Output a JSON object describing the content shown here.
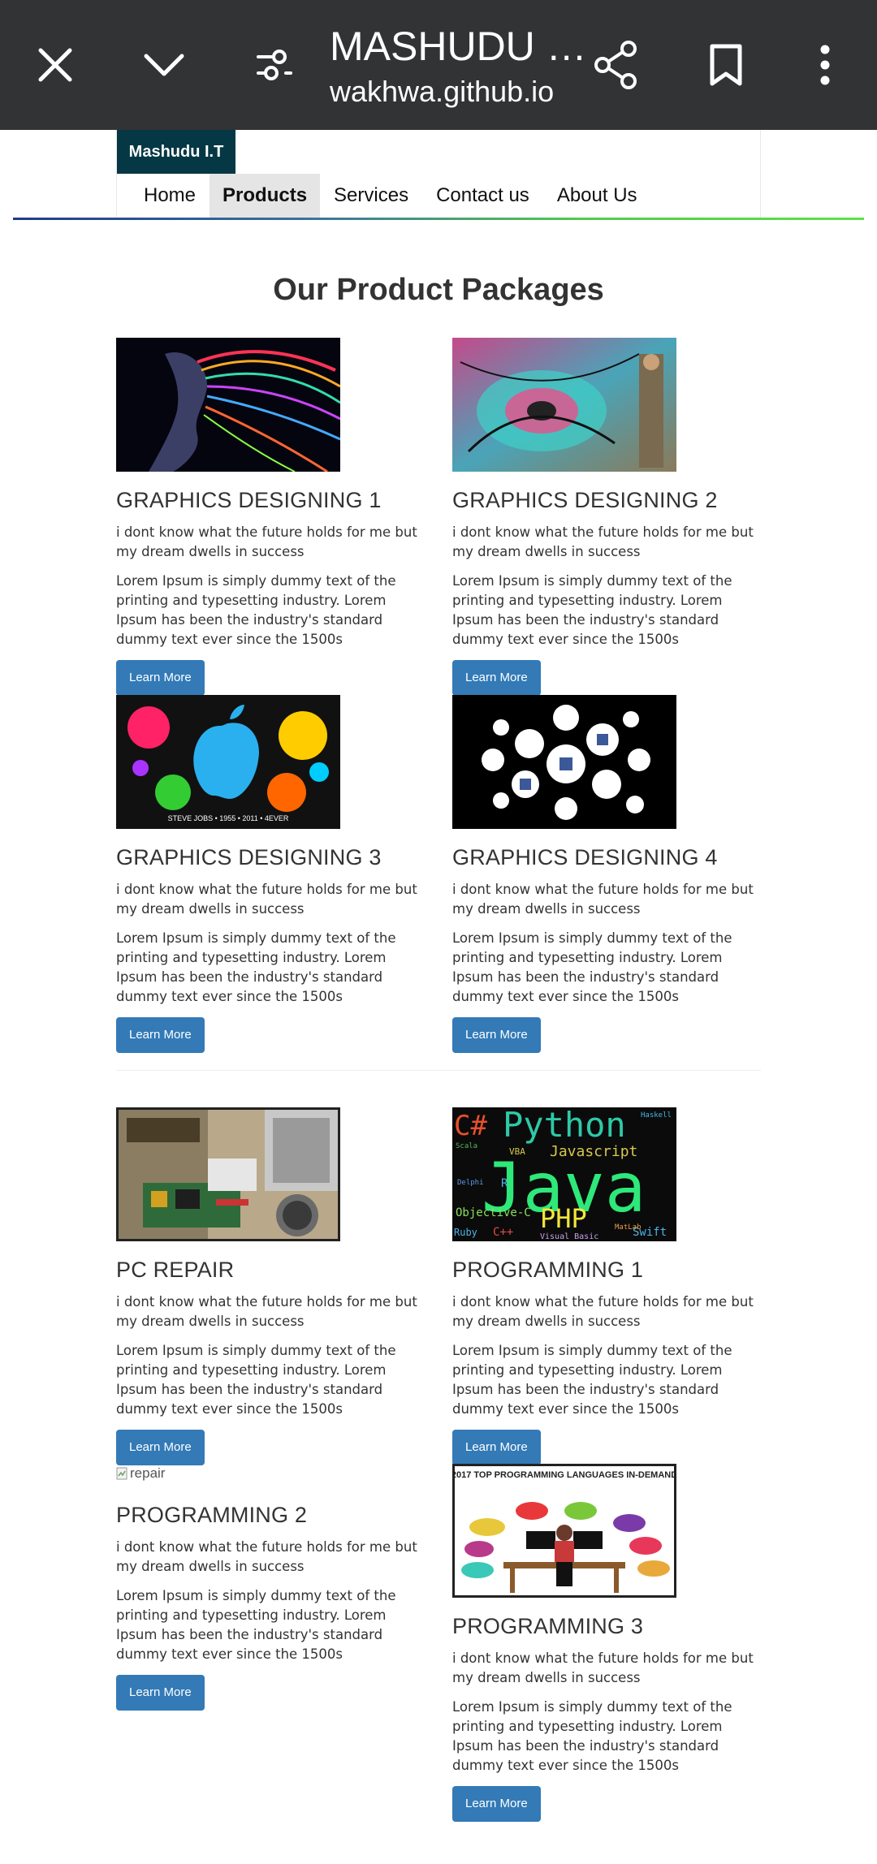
{
  "browser": {
    "title": "MASHUDU …",
    "url": "wakhwa.github.io",
    "icons": [
      "close-icon",
      "chevron-down-icon",
      "settings-sliders-icon",
      "share-icon",
      "bookmark-icon",
      "more-vert-icon"
    ]
  },
  "nav": {
    "brand": "Mashudu I.T",
    "links": [
      "Home",
      "Products",
      "Services",
      "Contact us",
      "About Us"
    ],
    "active": "Products"
  },
  "page": {
    "heading": "Our Product Packages"
  },
  "cards": [
    {
      "title": "GRAPHICS DESIGNING 1",
      "subtitle": "i dont know what the future holds for me but my dream dwells in success",
      "description": "Lorem Ipsum is simply dummy text of the printing and typesetting industry. Lorem Ipsum has been the industry's standard dummy text ever since the 1500s",
      "button": "Learn More"
    },
    {
      "title": "GRAPHICS DESIGNING 2",
      "subtitle": "i dont know what the future holds for me but my dream dwells in success",
      "description": "Lorem Ipsum is simply dummy text of the printing and typesetting industry. Lorem Ipsum has been the industry's standard dummy text ever since the 1500s",
      "button": "Learn More"
    },
    {
      "title": "GRAPHICS DESIGNING 3",
      "subtitle": "i dont know what the future holds for me but my dream dwells in success",
      "description": "Lorem Ipsum is simply dummy text of the printing and typesetting industry. Lorem Ipsum has been the industry's standard dummy text ever since the 1500s",
      "button": "Learn More",
      "image_text": "STEVE JOBS • 1955 • 2011 • 4EVER"
    },
    {
      "title": "GRAPHICS DESIGNING 4",
      "subtitle": "i dont know what the future holds for me but my dream dwells in success",
      "description": "Lorem Ipsum is simply dummy text of the printing and typesetting industry. Lorem Ipsum has been the industry's standard dummy text ever since the 1500s",
      "button": "Learn More"
    },
    {
      "title": "PC REPAIR",
      "subtitle": "i dont know what the future holds for me but my dream dwells in success",
      "description": "Lorem Ipsum is simply dummy text of the printing and typesetting industry. Lorem Ipsum has been the industry's standard dummy text ever since the 1500s",
      "button": "Learn More"
    },
    {
      "title": "PROGRAMMING 1",
      "subtitle": "i dont know what the future holds for me but my dream dwells in success",
      "description": "Lorem Ipsum is simply dummy text of the printing and typesetting industry. Lorem Ipsum has been the industry's standard dummy text ever since the 1500s",
      "button": "Learn More",
      "image_words": [
        "C#",
        "Python",
        "Javascript",
        "Java",
        "PHP",
        "Objective-C",
        "Ruby",
        "C++",
        "Swift",
        "Visual Basic",
        "Delphi",
        "Scala",
        "VBA",
        "R",
        "MatLab",
        "Haskell"
      ]
    },
    {
      "title": "PROGRAMMING 2",
      "subtitle": "i dont know what the future holds for me but my dream dwells in success",
      "description": "Lorem Ipsum is simply dummy text of the printing and typesetting industry. Lorem Ipsum has been the industry's standard dummy text ever since the 1500s",
      "button": "Learn More",
      "image_alt": "repair"
    },
    {
      "title": "PROGRAMMING 3",
      "subtitle": "i dont know what the future holds for me but my dream dwells in success",
      "description": "Lorem Ipsum is simply dummy text of the printing and typesetting industry. Lorem Ipsum has been the industry's standard dummy text ever since the 1500s",
      "button": "Learn More",
      "image_text": "2017 TOP PROGRAMMING LANGUAGES IN-DEMAND"
    }
  ],
  "colors": {
    "topbar": "#323335",
    "brand_bg": "#053844",
    "button": "#337ab7",
    "active_tab": "#e5e5e5"
  }
}
